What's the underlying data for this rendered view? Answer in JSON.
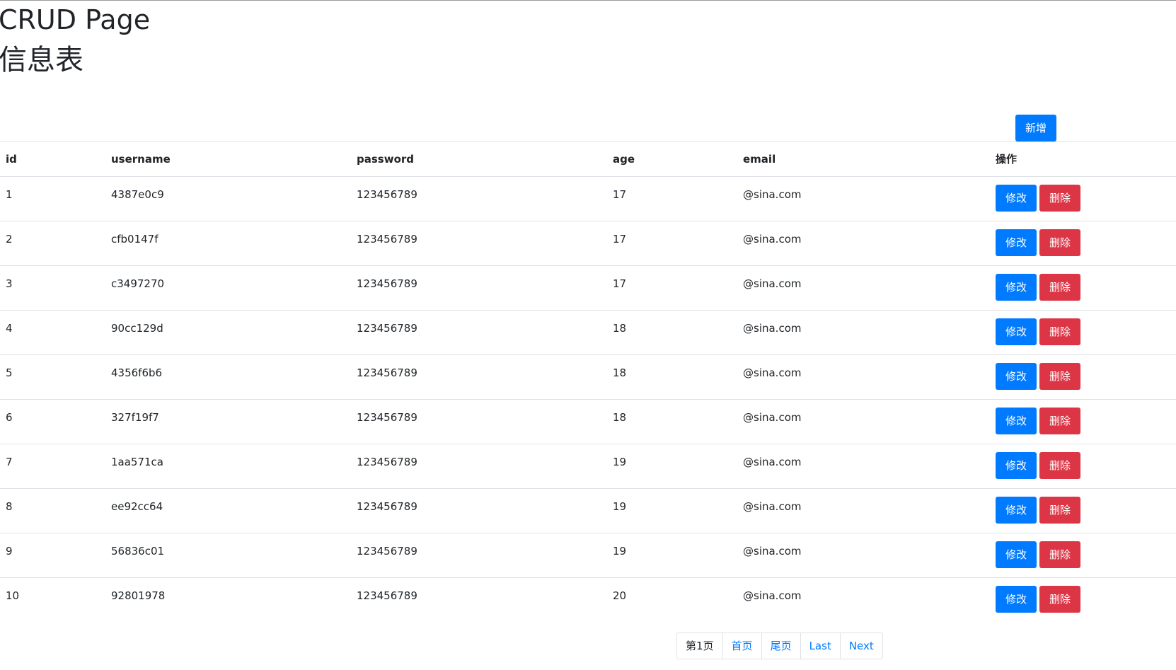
{
  "header": {
    "title": "CRUD Page",
    "subtitle": "信息表"
  },
  "toolbar": {
    "add_label": "新增"
  },
  "table": {
    "columns": [
      "id",
      "username",
      "password",
      "age",
      "email",
      "操作"
    ],
    "rows": [
      {
        "id": "1",
        "username": "4387e0c9",
        "password": "123456789",
        "age": "17",
        "email": "@sina.com"
      },
      {
        "id": "2",
        "username": "cfb0147f",
        "password": "123456789",
        "age": "17",
        "email": "@sina.com"
      },
      {
        "id": "3",
        "username": "c3497270",
        "password": "123456789",
        "age": "17",
        "email": "@sina.com"
      },
      {
        "id": "4",
        "username": "90cc129d",
        "password": "123456789",
        "age": "18",
        "email": "@sina.com"
      },
      {
        "id": "5",
        "username": "4356f6b6",
        "password": "123456789",
        "age": "18",
        "email": "@sina.com"
      },
      {
        "id": "6",
        "username": "327f19f7",
        "password": "123456789",
        "age": "18",
        "email": "@sina.com"
      },
      {
        "id": "7",
        "username": "1aa571ca",
        "password": "123456789",
        "age": "19",
        "email": "@sina.com"
      },
      {
        "id": "8",
        "username": "ee92cc64",
        "password": "123456789",
        "age": "19",
        "email": "@sina.com"
      },
      {
        "id": "9",
        "username": "56836c01",
        "password": "123456789",
        "age": "19",
        "email": "@sina.com"
      },
      {
        "id": "10",
        "username": "92801978",
        "password": "123456789",
        "age": "20",
        "email": "@sina.com"
      }
    ],
    "edit_label": "修改",
    "delete_label": "删除"
  },
  "pagination": {
    "current": "第1页",
    "first": "首页",
    "end": "尾页",
    "last": "Last",
    "next": "Next"
  },
  "colors": {
    "primary": "#007bff",
    "danger": "#dc3545",
    "text": "#212529",
    "border": "#dee2e6"
  }
}
